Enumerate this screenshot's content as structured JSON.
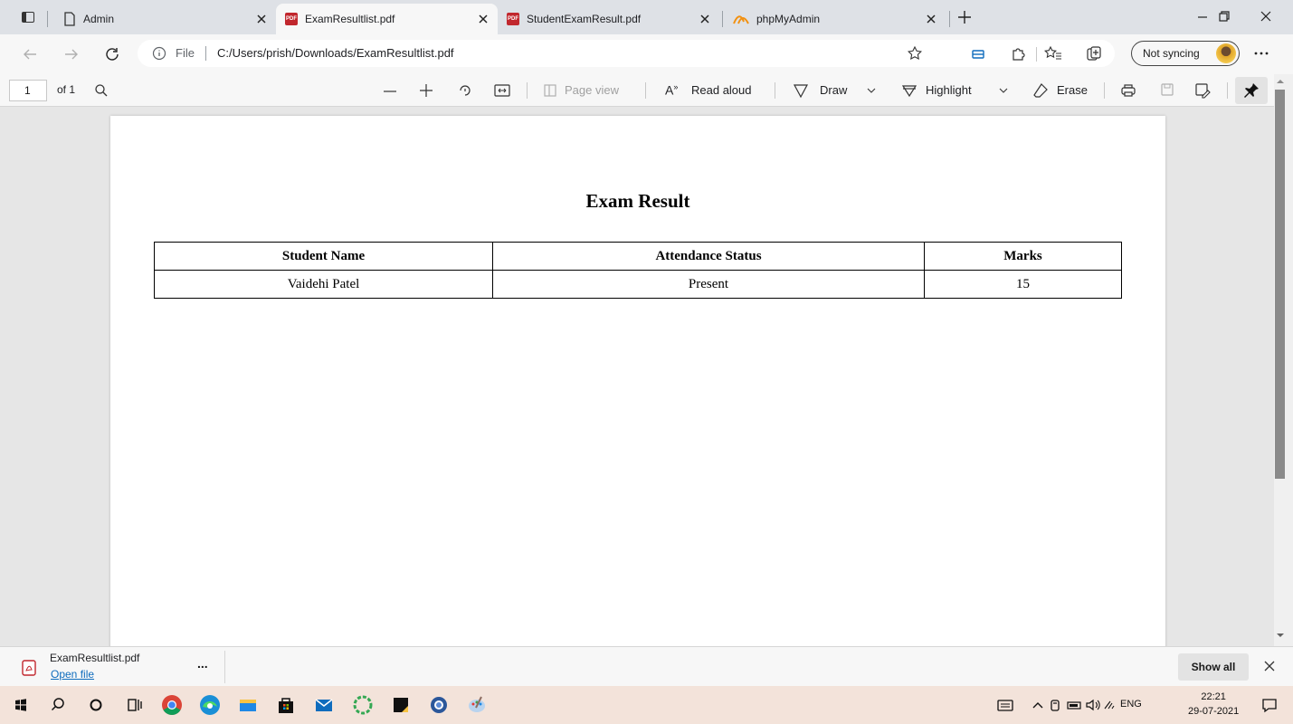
{
  "tabs": [
    {
      "title": "Admin",
      "icon": "page-icon",
      "active": false
    },
    {
      "title": "ExamResultlist.pdf",
      "icon": "pdf-icon",
      "active": true
    },
    {
      "title": "StudentExamResult.pdf",
      "icon": "pdf-icon",
      "active": false
    },
    {
      "title": "phpMyAdmin",
      "icon": "phpmyadmin-icon",
      "active": false
    }
  ],
  "address": {
    "scheme_label": "File",
    "url": "C:/Users/prish/Downloads/ExamResultlist.pdf",
    "sync_label": "Not syncing"
  },
  "pdf_toolbar": {
    "page_number": "1",
    "page_count": "of 1",
    "page_view": "Page view",
    "read_aloud": "Read aloud",
    "draw": "Draw",
    "highlight": "Highlight",
    "erase": "Erase"
  },
  "document": {
    "title": "Exam Result",
    "columns": [
      "Student Name",
      "Attendance Status",
      "Marks"
    ],
    "rows": [
      [
        "Vaidehi Patel",
        "Present",
        "15"
      ]
    ]
  },
  "download": {
    "filename": "ExamResultlist.pdf",
    "action": "Open file",
    "more": "...",
    "show_all": "Show all"
  },
  "taskbar": {
    "language": "ENG",
    "time": "22:21",
    "date": "29-07-2021"
  },
  "colors": {
    "tabstrip": "#dee1e6",
    "toolbar": "#f7f7f7",
    "viewer_bg": "#e6e6e6",
    "pdf_red": "#c1272d",
    "link_blue": "#0f6cbd",
    "taskbar": "#f3e3da"
  }
}
